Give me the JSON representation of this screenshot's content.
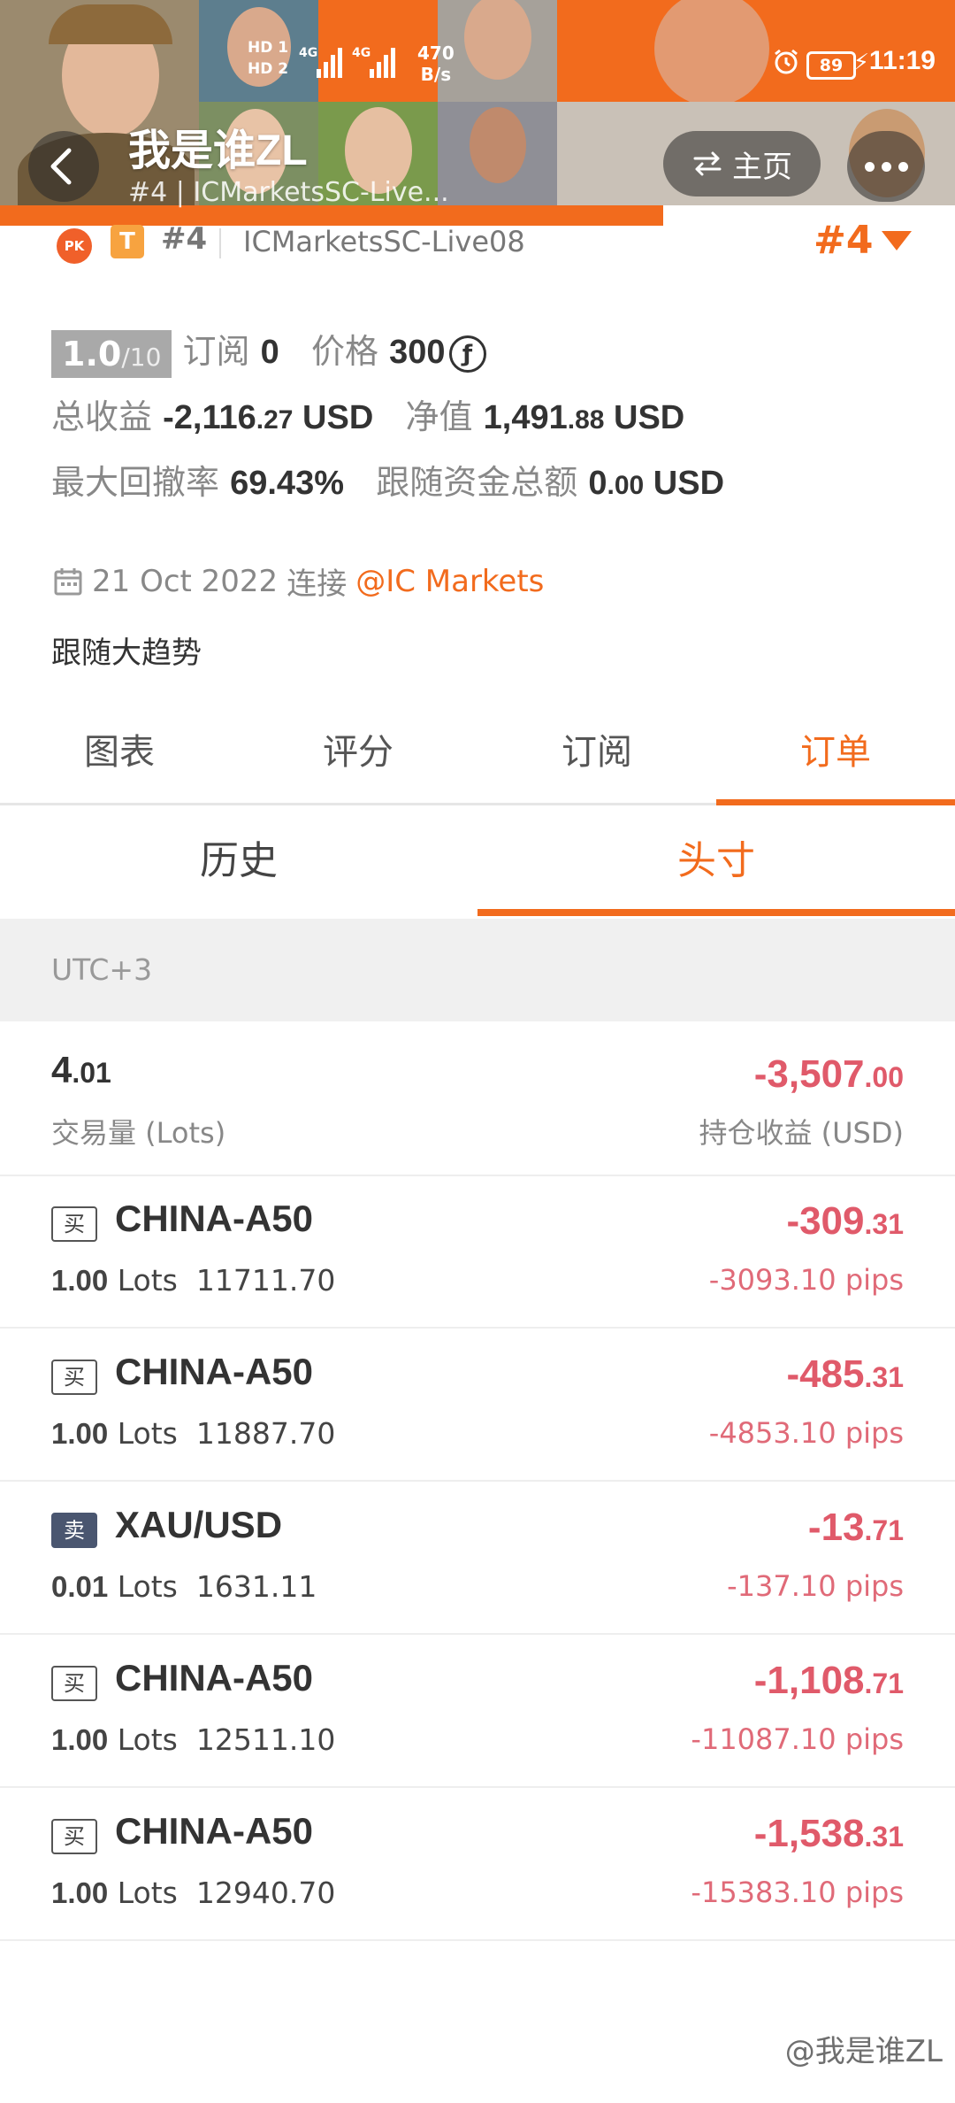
{
  "statusbar": {
    "hd1": "HD 1",
    "hd2": "HD 2",
    "sig1": "4G",
    "sig2": "4G",
    "net_speed_value": "470",
    "net_speed_unit": "B/s",
    "battery": "89",
    "time": "11:19"
  },
  "header": {
    "title": "我是谁ZL",
    "subtitle": "#4 | ICMarketsSC-Live...",
    "home_label": "主页"
  },
  "profile": {
    "pk_badge": "PK",
    "t_badge": "T",
    "rank": "#4",
    "server": "ICMarketsSC-Live08",
    "rank_right": "#4",
    "score_main": "1.0",
    "score_total": "/10",
    "subscribe_label": "订阅",
    "subscribe_count": "0",
    "price_label": "价格",
    "price_value": "300",
    "coin_symbol": "ƒ",
    "total_profit_label": "总收益",
    "total_profit_main": "-2,116",
    "total_profit_dec": ".27",
    "total_profit_unit": "USD",
    "equity_label": "净值",
    "equity_main": "1,491",
    "equity_dec": ".88",
    "equity_unit": "USD",
    "drawdown_label": "最大回撤率",
    "drawdown_value": "69.43%",
    "follow_label": "跟随资金总额",
    "follow_main": "0",
    "follow_dec": ".00",
    "follow_unit": "USD",
    "date": "21 Oct 2022",
    "connect_label": "连接",
    "broker": "@IC Markets",
    "description": "跟随大趋势"
  },
  "tabs": [
    {
      "label": "图表",
      "active": false
    },
    {
      "label": "评分",
      "active": false
    },
    {
      "label": "订阅",
      "active": false
    },
    {
      "label": "订单",
      "active": true
    }
  ],
  "subtabs": [
    {
      "label": "历史",
      "active": false
    },
    {
      "label": "头寸",
      "active": true
    }
  ],
  "timezone": "UTC+3",
  "summary": {
    "lots_main": "4",
    "lots_dec": ".01",
    "lots_label": "交易量 (Lots)",
    "pnl_main": "-3,507",
    "pnl_dec": ".00",
    "pnl_label": "持仓收益 (USD)"
  },
  "positions": [
    {
      "side": "买",
      "side_type": "buy",
      "symbol": "CHINA-A50",
      "lots": "1.00",
      "lots_unit": "Lots",
      "price": "11711.70",
      "pnl_main": "-309",
      "pnl_dec": ".31",
      "pips": "-3093.10 pips"
    },
    {
      "side": "买",
      "side_type": "buy",
      "symbol": "CHINA-A50",
      "lots": "1.00",
      "lots_unit": "Lots",
      "price": "11887.70",
      "pnl_main": "-485",
      "pnl_dec": ".31",
      "pips": "-4853.10 pips"
    },
    {
      "side": "卖",
      "side_type": "sell",
      "symbol": "XAU/USD",
      "lots": "0.01",
      "lots_unit": "Lots",
      "price": "1631.11",
      "pnl_main": "-13",
      "pnl_dec": ".71",
      "pips": "-137.10 pips"
    },
    {
      "side": "买",
      "side_type": "buy",
      "symbol": "CHINA-A50",
      "lots": "1.00",
      "lots_unit": "Lots",
      "price": "12511.10",
      "pnl_main": "-1,108",
      "pnl_dec": ".71",
      "pips": "-11087.10 pips"
    },
    {
      "side": "买",
      "side_type": "buy",
      "symbol": "CHINA-A50",
      "lots": "1.00",
      "lots_unit": "Lots",
      "price": "12940.70",
      "pnl_main": "-1,538",
      "pnl_dec": ".31",
      "pips": "-15383.10 pips"
    }
  ],
  "watermark": "@我是谁ZL",
  "colors": {
    "accent": "#f26b1d",
    "loss": "#e05a6a",
    "sell_badge": "#4a5670"
  }
}
